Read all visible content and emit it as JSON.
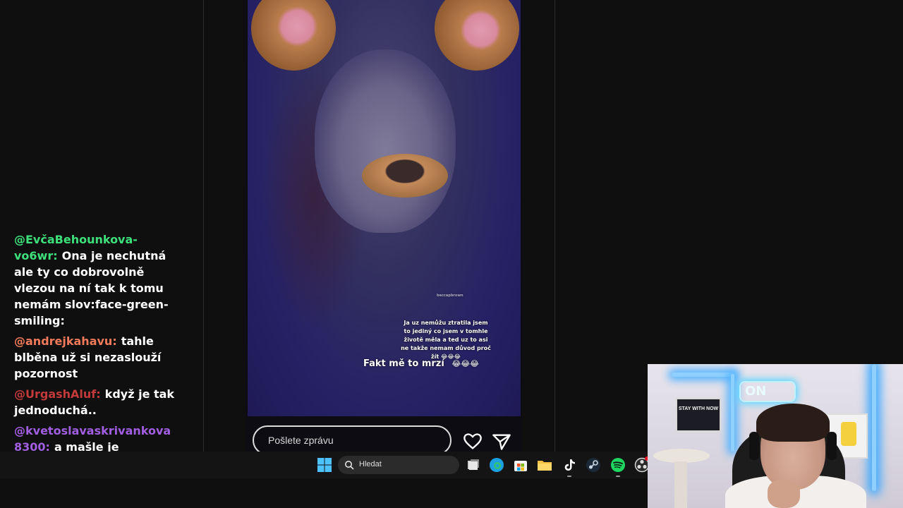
{
  "chat": {
    "messages": [
      {
        "user": "@EvčaBehounkova-vo6wr",
        "sep": ":",
        "text": "Ona je nechutná ale ty co dobrovolně vlezou na ní tak k tomu nemám slov:face-green-smiling:",
        "color": "#3de07a"
      },
      {
        "user": "@andrejkahavu",
        "sep": ":",
        "text": "tahle blběna už si nezaslouží pozornost",
        "color": "#f07a5a"
      },
      {
        "user": "@UrgashAluf",
        "sep": ":",
        "text": "když je tak jednoduchá..",
        "color": "#c23a3a"
      },
      {
        "user": "@kvetoslavaskrivankova8300",
        "sep": ":",
        "text": "a mašle je blboučká",
        "color": "#a15ee0"
      }
    ]
  },
  "video": {
    "overlay_caption": "Ja uz nemůžu ztratila jsem to jediný co jsem v tomhle životě měla a ted uz to asi ne takže nemam důvod proč žít 😂😂😂",
    "overlay_big": "Fakt mě to mrzí",
    "overlay_big_emoji": "😂😂😂",
    "watermark": "beccapbrown",
    "message_placeholder": "Pošlete zprávu"
  },
  "taskbar": {
    "search_label": "Hledat",
    "apps": [
      "windows-start",
      "task-view",
      "edge",
      "microsoft-store",
      "file-explorer",
      "tiktok",
      "steam",
      "spotify",
      "obs"
    ]
  },
  "webcam": {
    "neon_sign": "ON",
    "poster_text": "STAY WITH NOW"
  },
  "colors": {
    "background": "#0f0f0f",
    "video_bg": "#262165",
    "taskbar": "#141414"
  }
}
